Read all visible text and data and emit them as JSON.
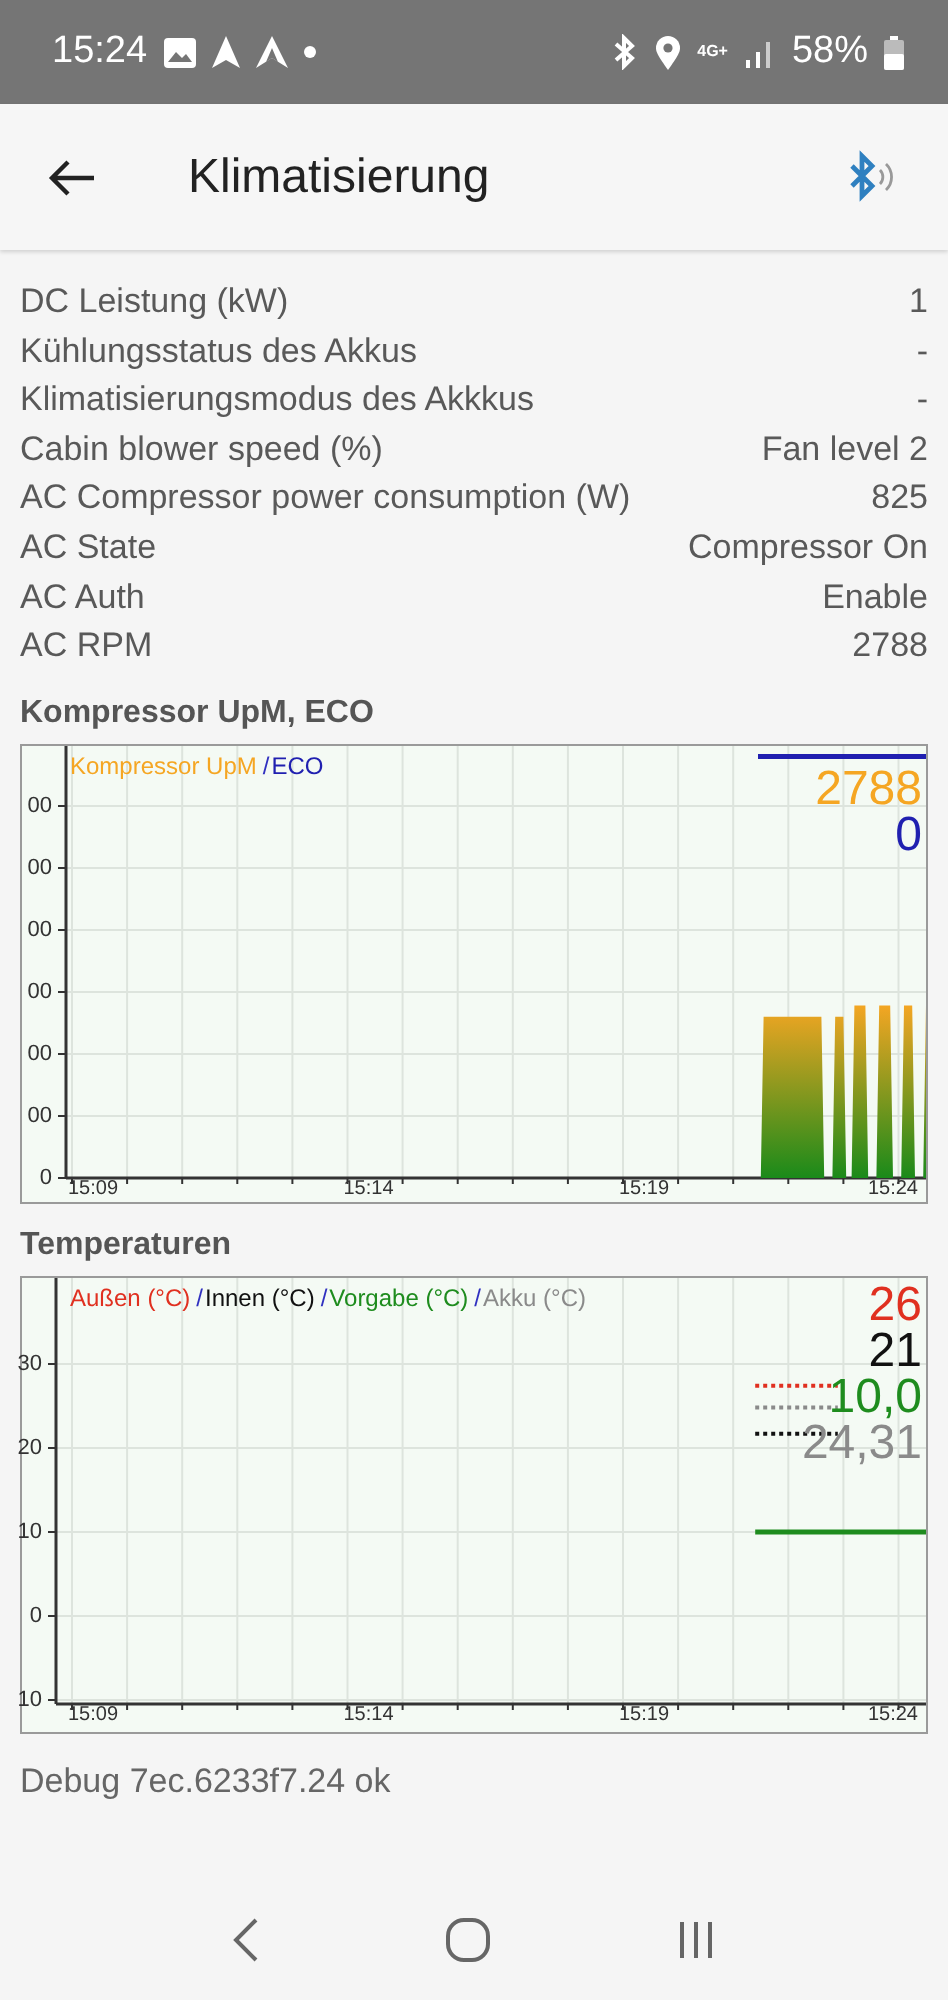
{
  "status_bar": {
    "time": "15:24",
    "network": "4G+",
    "battery": "58%"
  },
  "app_bar": {
    "title": "Klimatisierung"
  },
  "rows": [
    {
      "label": "DC Leistung (kW)",
      "value": "1"
    },
    {
      "label": "Kühlungsstatus des Akkus",
      "value": "-"
    },
    {
      "label": "Klimatisierungsmodus des Akkkus",
      "value": "-"
    },
    {
      "label": "Cabin blower speed (%)",
      "value": "Fan level 2"
    },
    {
      "label": "AC Compressor power consumption (W)",
      "value": "825"
    },
    {
      "label": "AC State",
      "value": "Compressor On"
    },
    {
      "label": "AC Auth",
      "value": "Enable"
    },
    {
      "label": "AC RPM",
      "value": "2788"
    }
  ],
  "charts": [
    {
      "title": "Kompressor UpM, ECO",
      "legend": [
        {
          "label": "Kompressor UpM",
          "color": "#f5a623",
          "reading": "2788"
        },
        {
          "separator": "/",
          "label": "ECO",
          "color": "#2020b0",
          "reading": "0"
        }
      ],
      "y_labels": [
        "00",
        "00",
        "00",
        "00",
        "00",
        "00",
        "0"
      ],
      "x_labels": [
        "15:09",
        "15:14",
        "15:19",
        "15:24"
      ]
    },
    {
      "title": "Temperaturen",
      "legend": [
        {
          "label": "Außen (°C)",
          "color": "#e03020",
          "reading": "26"
        },
        {
          "separator": "/",
          "label": "Innen (°C)",
          "color": "#111111",
          "reading": "21"
        },
        {
          "separator": "/",
          "label": "Vorgabe (°C)",
          "color": "#1e8c1e",
          "reading": "10,0"
        },
        {
          "separator": "/",
          "label": "Akku (°C)",
          "color": "#8a8a8a",
          "reading": "24,31"
        }
      ],
      "y_labels": [
        "30",
        "20",
        "10",
        "0",
        "10"
      ],
      "x_labels": [
        "15:09",
        "15:14",
        "15:19",
        "15:24"
      ]
    }
  ],
  "debug": "Debug 7ec.6233f7.24 ok"
}
